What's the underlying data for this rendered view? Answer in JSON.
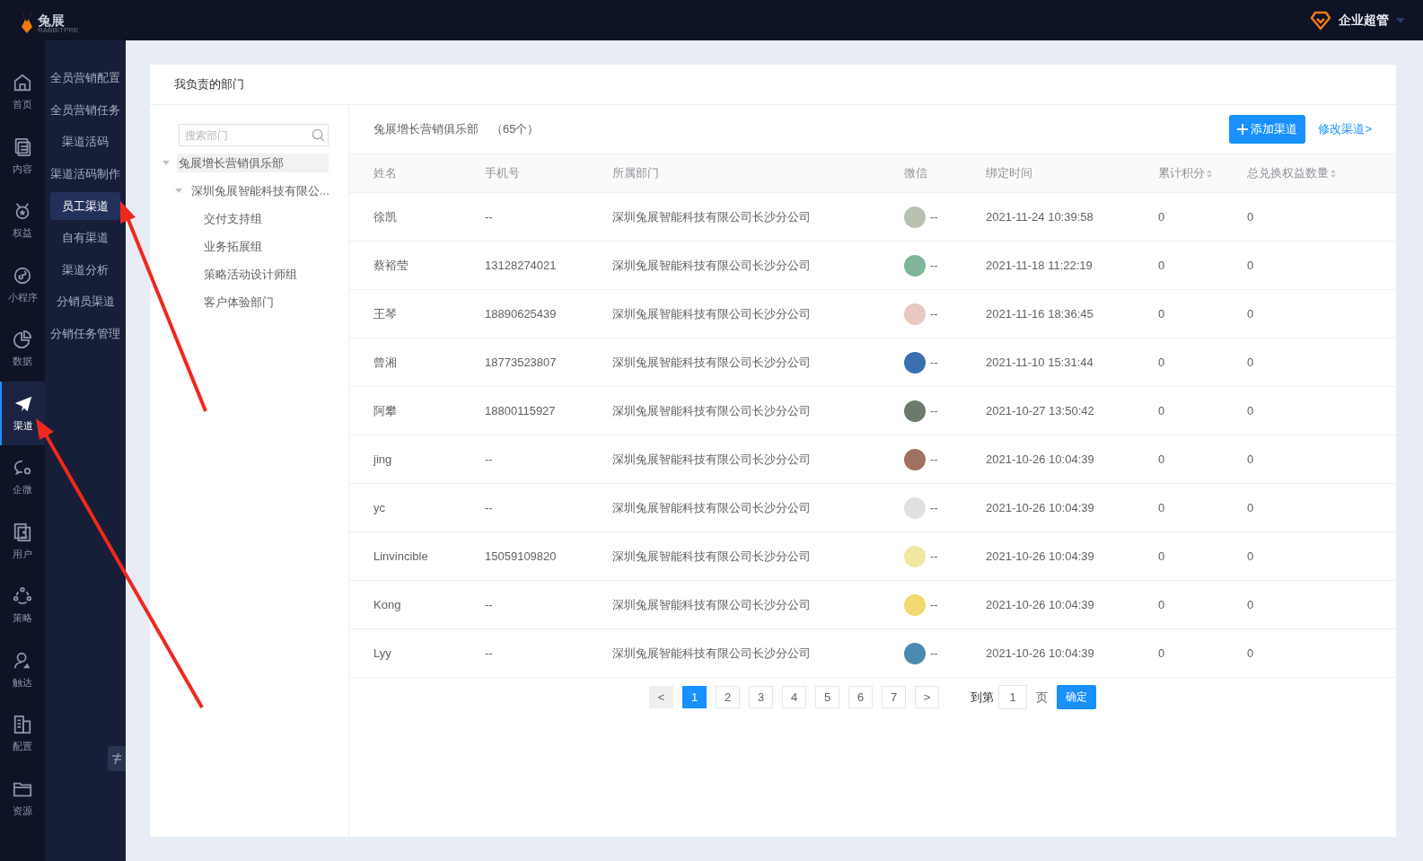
{
  "header": {
    "logo_text": "兔展",
    "logo_subtext": "RABBITPRE",
    "user": "企业超管"
  },
  "rail": [
    {
      "label": "首页",
      "selected": false
    },
    {
      "label": "内容",
      "selected": false
    },
    {
      "label": "权益",
      "selected": false
    },
    {
      "label": "小程序",
      "selected": false
    },
    {
      "label": "数据",
      "selected": false
    },
    {
      "label": "渠道",
      "selected": true
    },
    {
      "label": "企微",
      "selected": false
    },
    {
      "label": "用户",
      "selected": false
    },
    {
      "label": "策略",
      "selected": false
    },
    {
      "label": "触达",
      "selected": false
    },
    {
      "label": "配置",
      "selected": false
    },
    {
      "label": "资源",
      "selected": false
    }
  ],
  "submenu": [
    {
      "label": "全员营销配置",
      "selected": false
    },
    {
      "label": "全员营销任务",
      "selected": false
    },
    {
      "label": "渠道活码",
      "selected": false
    },
    {
      "label": "渠道活码制作",
      "selected": false
    },
    {
      "label": "员工渠道",
      "selected": true
    },
    {
      "label": "自有渠道",
      "selected": false
    },
    {
      "label": "渠道分析",
      "selected": false
    },
    {
      "label": "分销员渠道",
      "selected": false
    },
    {
      "label": "分销任务管理",
      "selected": false
    }
  ],
  "card": {
    "title": "我负责的部门"
  },
  "tree": {
    "search_placeholder": "搜索部门",
    "nodes": [
      {
        "label": "兔展增长营销俱乐部",
        "selected": true,
        "expanded": true,
        "children": [
          {
            "label": "深圳兔展智能科技有限公...",
            "selected": false,
            "expanded": true,
            "children": [
              {
                "label": "交付支持组",
                "selected": false
              },
              {
                "label": "业务拓展组",
                "selected": false
              },
              {
                "label": "策略活动设计师组",
                "selected": false
              },
              {
                "label": "客户体验部门",
                "selected": false
              }
            ]
          }
        ]
      }
    ]
  },
  "table": {
    "title": "兔展增长营销俱乐部",
    "count": "（65个）",
    "add_button": "添加渠道",
    "edit_link": "修改渠道>",
    "columns": [
      {
        "label": "姓名",
        "sortable": false
      },
      {
        "label": "手机号",
        "sortable": false
      },
      {
        "label": "所属部门",
        "sortable": false
      },
      {
        "label": "微信",
        "sortable": false
      },
      {
        "label": "绑定时间",
        "sortable": false
      },
      {
        "label": "累计积分",
        "sortable": true
      },
      {
        "label": "总兑换权益数量",
        "sortable": true
      }
    ],
    "rows": [
      {
        "name": "徐凯",
        "phone": "--",
        "department": "深圳兔展智能科技有限公司长沙分公司",
        "wechat": "--",
        "bind_time": "2021-11-24 10:39:58",
        "points": "0",
        "redeemed": "0"
      },
      {
        "name": "蔡裕莹",
        "phone": "13128274021",
        "department": "深圳兔展智能科技有限公司长沙分公司",
        "wechat": "--",
        "bind_time": "2021-11-18 11:22:19",
        "points": "0",
        "redeemed": "0"
      },
      {
        "name": "王琴",
        "phone": "18890625439",
        "department": "深圳兔展智能科技有限公司长沙分公司",
        "wechat": "--",
        "bind_time": "2021-11-16 18:36:45",
        "points": "0",
        "redeemed": "0"
      },
      {
        "name": "曾湘",
        "phone": "18773523807",
        "department": "深圳兔展智能科技有限公司长沙分公司",
        "wechat": "--",
        "bind_time": "2021-11-10 15:31:44",
        "points": "0",
        "redeemed": "0"
      },
      {
        "name": "阿攀",
        "phone": "18800115927",
        "department": "深圳兔展智能科技有限公司长沙分公司",
        "wechat": "--",
        "bind_time": "2021-10-27 13:50:42",
        "points": "0",
        "redeemed": "0"
      },
      {
        "name": "jing",
        "phone": "--",
        "department": "深圳兔展智能科技有限公司长沙分公司",
        "wechat": "--",
        "bind_time": "2021-10-26 10:04:39",
        "points": "0",
        "redeemed": "0"
      },
      {
        "name": "yc",
        "phone": "--",
        "department": "深圳兔展智能科技有限公司长沙分公司",
        "wechat": "--",
        "bind_time": "2021-10-26 10:04:39",
        "points": "0",
        "redeemed": "0"
      },
      {
        "name": "Linvincible",
        "phone": "15059109820",
        "department": "深圳兔展智能科技有限公司长沙分公司",
        "wechat": "--",
        "bind_time": "2021-10-26 10:04:39",
        "points": "0",
        "redeemed": "0"
      },
      {
        "name": "Kong",
        "phone": "--",
        "department": "深圳兔展智能科技有限公司长沙分公司",
        "wechat": "--",
        "bind_time": "2021-10-26 10:04:39",
        "points": "0",
        "redeemed": "0"
      },
      {
        "name": "Lyy",
        "phone": "--",
        "department": "深圳兔展智能科技有限公司长沙分公司",
        "wechat": "--",
        "bind_time": "2021-10-26 10:04:39",
        "points": "0",
        "redeemed": "0"
      }
    ]
  },
  "pagination": {
    "prev": "<",
    "pages": [
      {
        "label": "1",
        "selected": true
      },
      {
        "label": "2",
        "selected": false
      },
      {
        "label": "3",
        "selected": false
      },
      {
        "label": "4",
        "selected": false
      },
      {
        "label": "5",
        "selected": false
      },
      {
        "label": "6",
        "selected": false
      },
      {
        "label": "7",
        "selected": false
      }
    ],
    "next": ">",
    "goto_label": "到第",
    "goto_value": "1",
    "goto_suffix": "页",
    "confirm": "确定"
  }
}
